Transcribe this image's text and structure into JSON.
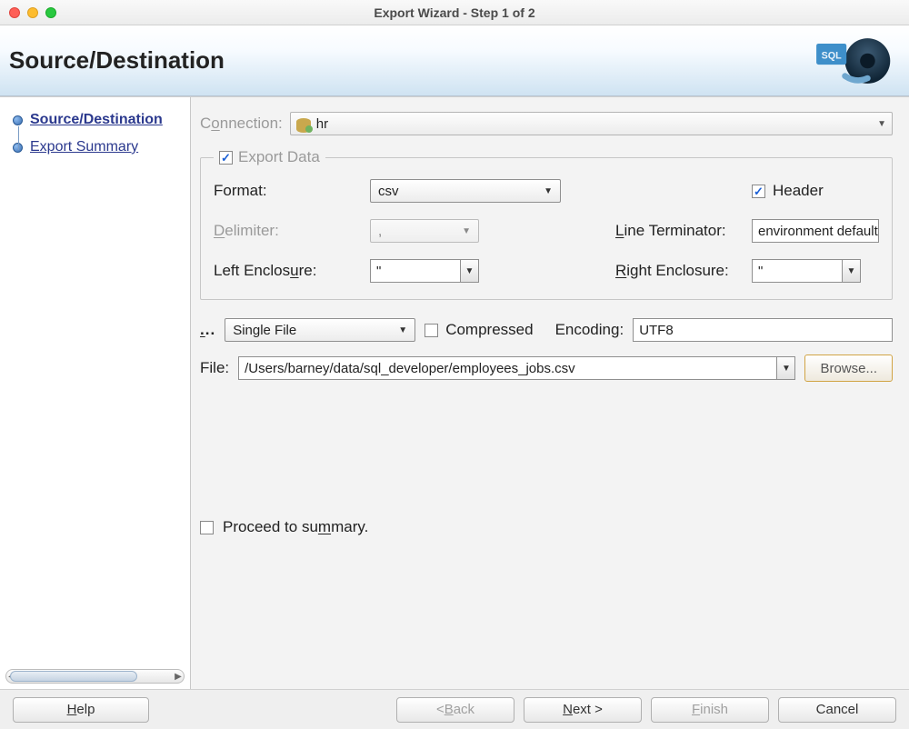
{
  "window": {
    "title": "Export Wizard - Step 1 of 2"
  },
  "banner": {
    "heading": "Source/Destination"
  },
  "sidebar": {
    "steps": [
      {
        "label": "Source/Destination",
        "current": true
      },
      {
        "label": "Export Summary",
        "current": false
      }
    ]
  },
  "connection": {
    "label_pre": "C",
    "label_ul": "o",
    "label_post": "nnection:",
    "value": "hr"
  },
  "export_data": {
    "legend_pre": "",
    "legend_ul": "E",
    "legend_post": "xport Data",
    "checked": true,
    "format_label": "Format:",
    "format_value": "csv",
    "header_label": "Header",
    "header_checked": true,
    "delimiter_label_pre": "",
    "delimiter_label_ul": "D",
    "delimiter_label_post": "elimiter:",
    "delimiter_value": ",",
    "line_term_label_pre": "",
    "line_term_label_ul": "L",
    "line_term_label_post": "ine Terminator:",
    "line_term_value": "environment default",
    "left_encl_label_pre": "Left Enclos",
    "left_encl_label_ul": "u",
    "left_encl_label_post": "re:",
    "left_encl_value": "\"",
    "right_encl_label_pre": "",
    "right_encl_label_ul": "R",
    "right_encl_label_post": "ight Enclosure:",
    "right_encl_value": "\""
  },
  "output": {
    "ellipsis_label_ul": ".",
    "ellipsis_label_post": "..",
    "mode_value": "Single File",
    "compressed_label": "Compressed",
    "compressed_checked": false,
    "encoding_label": "Encoding:",
    "encoding_value": "UTF8"
  },
  "file": {
    "label": "File:",
    "value": "/Users/barney/data/sql_developer/employees_jobs.csv",
    "browse_label": "Browse..."
  },
  "proceed": {
    "label_pre": "Proceed to su",
    "label_ul": "m",
    "label_post": "mary.",
    "checked": false
  },
  "footer": {
    "help_pre": "",
    "help_ul": "H",
    "help_post": "elp",
    "back_pre": "< ",
    "back_ul": "B",
    "back_post": "ack",
    "next_pre": "",
    "next_ul": "N",
    "next_post": "ext >",
    "finish_pre": "",
    "finish_ul": "F",
    "finish_post": "inish",
    "cancel": "Cancel"
  }
}
